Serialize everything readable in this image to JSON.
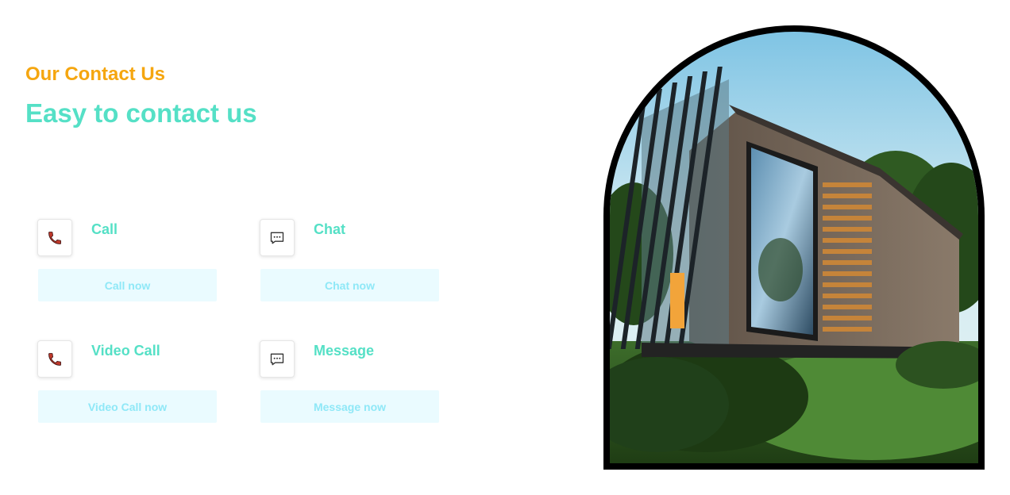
{
  "section": {
    "eyebrow": "Our Contact Us",
    "headline": "Easy to contact us"
  },
  "cards": [
    {
      "title": "Call",
      "button_label": "Call now",
      "icon": "phone-icon"
    },
    {
      "title": "Chat",
      "button_label": "Chat now",
      "icon": "chat-bubble-icon"
    },
    {
      "title": "Video Call",
      "button_label": "Video Call now",
      "icon": "phone-icon"
    },
    {
      "title": "Message",
      "button_label": "Message now",
      "icon": "chat-bubble-icon"
    }
  ],
  "colors": {
    "eyebrow": "#f5a60f",
    "accent": "#55e0c6",
    "button_bg": "#eafbff",
    "button_text": "#8fe8f7",
    "phone_icon": "#c0392b"
  },
  "hero": {
    "image": "modern-container-house-photo"
  }
}
